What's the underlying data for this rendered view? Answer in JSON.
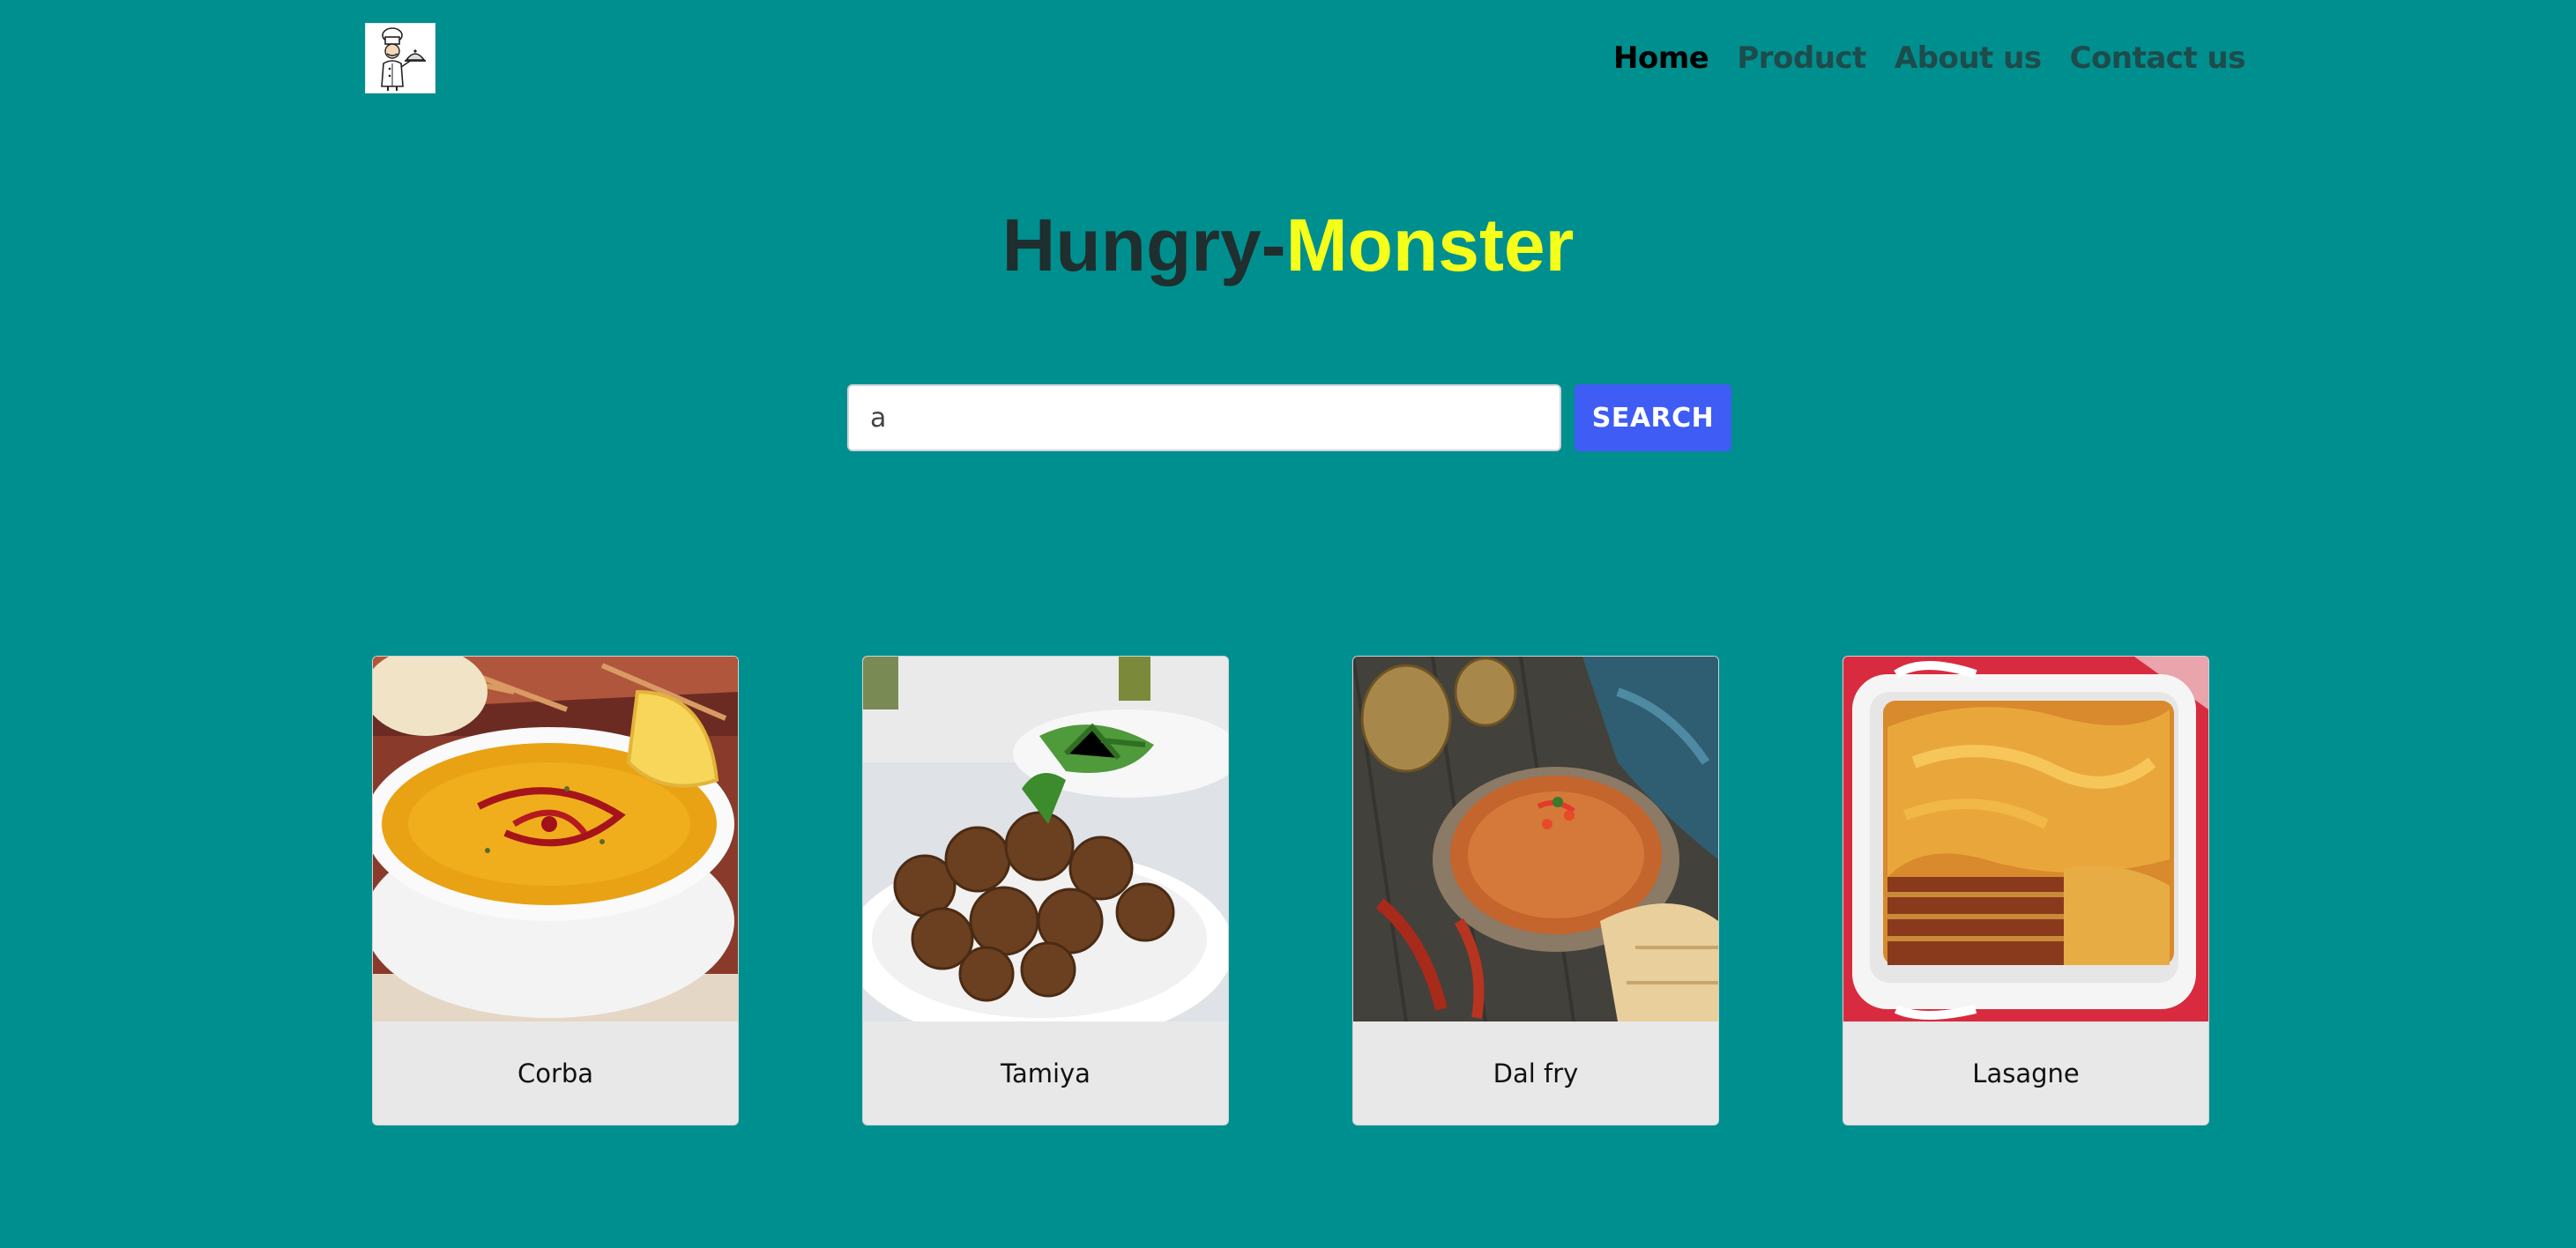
{
  "header": {
    "nav": {
      "home": "Home",
      "product": "Product",
      "about": "About us",
      "contact": "Contact us"
    }
  },
  "hero": {
    "title_part1": "Hungry-",
    "title_part2": "Monster"
  },
  "search": {
    "value": "a",
    "button_label": "SEARCH"
  },
  "meals": [
    {
      "name": "Corba",
      "image": "soup-bowl-image"
    },
    {
      "name": "Tamiya",
      "image": "falafel-plate-image"
    },
    {
      "name": "Dal fry",
      "image": "curry-bowl-image"
    },
    {
      "name": "Lasagne",
      "image": "lasagne-dish-image"
    }
  ],
  "colors": {
    "background": "#008f8f",
    "accent_yellow": "#f5ff1a",
    "button_blue": "#3f5cf5",
    "card_footer": "#e8e8e8"
  }
}
